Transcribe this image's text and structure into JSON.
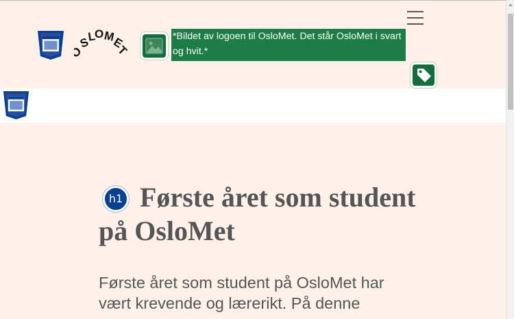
{
  "header": {
    "menu_icon": "hamburger-menu-icon",
    "html5_badge_icon": "html5-semantic-badge-icon",
    "logo_text": "OSLOMET",
    "image_badge_icon": "image-icon",
    "image_alt_text": "*Bildet av logoen til OsloMet. Det står OsloMet i svart og hvit.*",
    "tag_badge_icon": "tag-icon"
  },
  "nav": {
    "html5_badge_icon": "html5-semantic-badge-icon"
  },
  "main": {
    "heading_badge": "h1",
    "title": "Første året som student på OsloMet",
    "intro_text": "Første året som student på OsloMet har vært krevende og lærerikt. På denne"
  },
  "colors": {
    "page_background": "#fdf1e9",
    "accent_green": "#1e7d46",
    "badge_blue": "#0b3f8f",
    "text_gray": "#555555"
  }
}
